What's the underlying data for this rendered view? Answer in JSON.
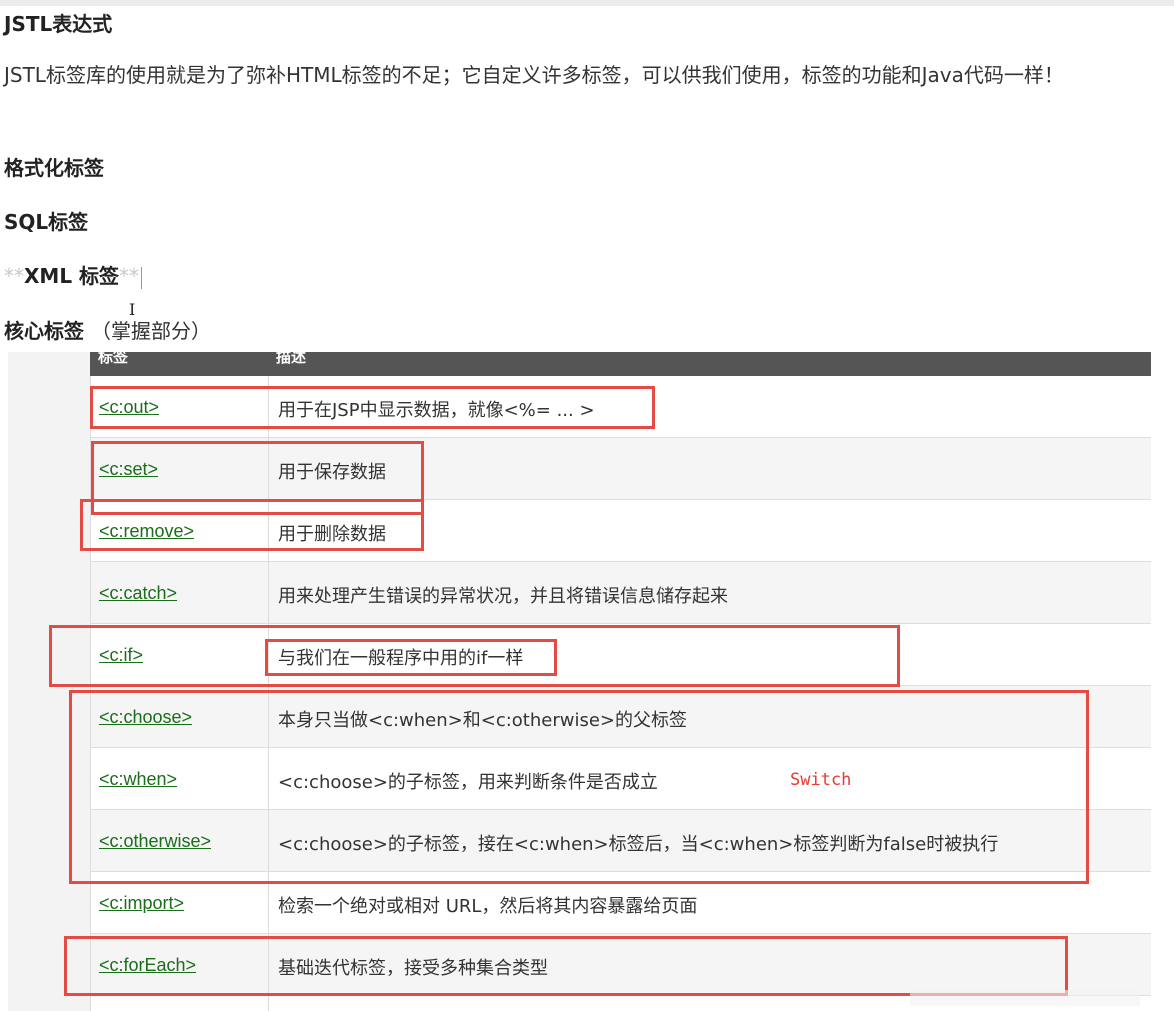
{
  "headings": {
    "jstl": "JSTL表达式",
    "format": "格式化标签",
    "sql": "SQL标签",
    "xml_stars_left": "**",
    "xml": "XML 标签",
    "xml_stars_right": "**",
    "core": "核心标签",
    "core_note": "（掌握部分）"
  },
  "intro": "JSTL标签库的使用就是为了弥补HTML标签的不足；它自定义许多标签，可以供我们使用，标签的功能和Java代码一样！",
  "table": {
    "header": [
      "标签",
      "描述"
    ],
    "rows": [
      {
        "tag": "<c:out>",
        "desc": "用于在JSP中显示数据，就像<%= ... >"
      },
      {
        "tag": "<c:set>",
        "desc": "用于保存数据"
      },
      {
        "tag": "<c:remove>",
        "desc": "用于删除数据"
      },
      {
        "tag": "<c:catch>",
        "desc": "用来处理产生错误的异常状况，并且将错误信息储存起来"
      },
      {
        "tag": "<c:if>",
        "desc": "与我们在一般程序中用的if一样"
      },
      {
        "tag": "<c:choose>",
        "desc": "本身只当做<c:when>和<c:otherwise>的父标签"
      },
      {
        "tag": "<c:when>",
        "desc": "<c:choose>的子标签，用来判断条件是否成立"
      },
      {
        "tag": "<c:otherwise>",
        "desc": "<c:choose>的子标签，接在<c:when>标签后，当<c:when>标签判断为false时被执行"
      },
      {
        "tag": "<c:import>",
        "desc": "检索一个绝对或相对 URL，然后将其内容暴露给页面"
      },
      {
        "tag": "<c:forEach>",
        "desc": "基础迭代标签，接受多种集合类型"
      }
    ]
  },
  "annotation": "Switch",
  "colors": {
    "link": "#1a6e1a",
    "annotation_red": "#e24c44",
    "header_bg": "#555555"
  }
}
